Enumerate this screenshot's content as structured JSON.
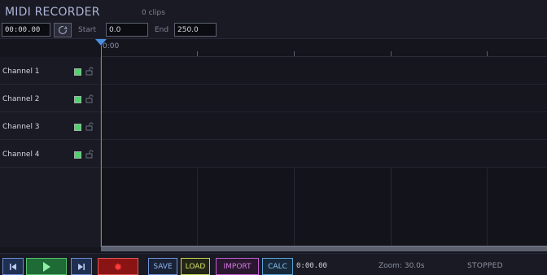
{
  "header": {
    "title": "MIDI RECORDER",
    "clip_count": "0 clips",
    "time_value": "00:00.00",
    "start_label": "Start",
    "start_value": "0.0",
    "end_label": "End",
    "end_value": "250.0"
  },
  "ruler": {
    "start_label": "0:00"
  },
  "tracks": [
    {
      "name": "Channel 1",
      "enabled": true
    },
    {
      "name": "Channel 2",
      "enabled": true
    },
    {
      "name": "Channel 3",
      "enabled": true
    },
    {
      "name": "Channel 4",
      "enabled": true
    }
  ],
  "transport": {
    "save_label": "SAVE",
    "load_label": "LOAD",
    "import_label": "IMPORT",
    "calc_label": "CALC",
    "time": "0:00.00",
    "zoom": "Zoom: 30.0s",
    "status": "STOPPED"
  },
  "colors": {
    "playhead": "#4a8fe0",
    "channel_enabled": "#4fd36b",
    "record": "#8a1414",
    "play": "#1e6b36"
  }
}
